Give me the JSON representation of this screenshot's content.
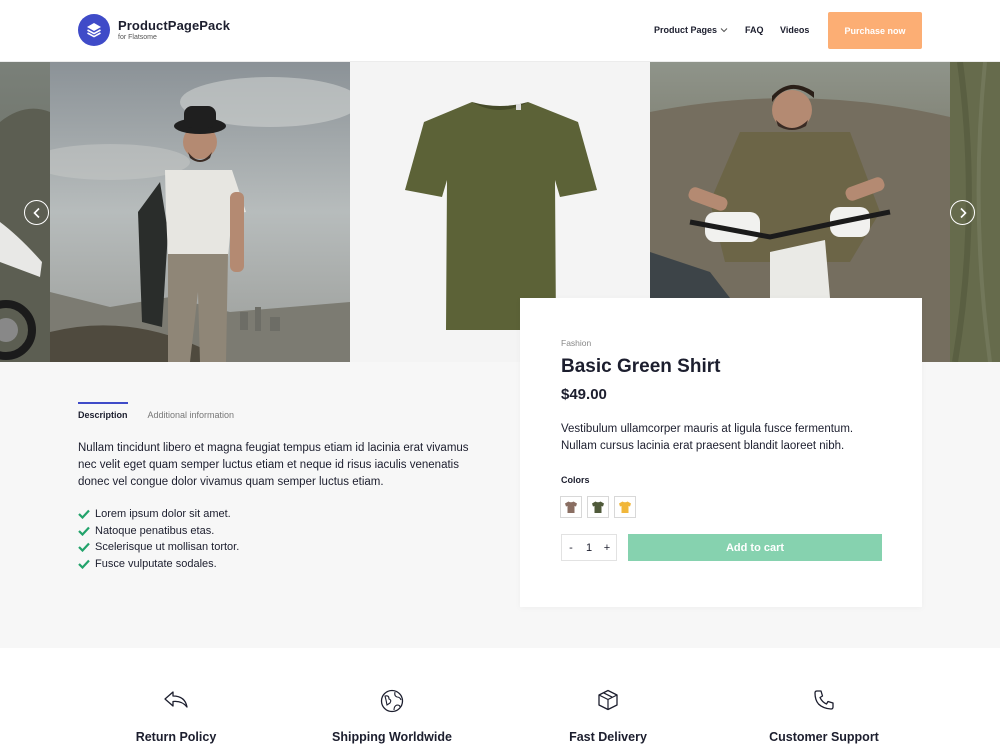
{
  "brand": {
    "name": "ProductPagePack",
    "sub": "for Flatsome"
  },
  "nav": {
    "items": [
      {
        "label": "Product Pages"
      },
      {
        "label": "FAQ"
      },
      {
        "label": "Videos"
      }
    ],
    "purchase_label": "Purchase now"
  },
  "tabs": [
    {
      "label": "Description"
    },
    {
      "label": "Additional information"
    }
  ],
  "description": "Nullam tincidunt libero et magna feugiat tempus etiam id lacinia erat vivamus nec velit eget quam semper luctus etiam et neque id risus iaculis venenatis donec vel congue dolor vivamus quam semper luctus etiam.",
  "checklist": [
    "Lorem ipsum dolor sit amet.",
    "Natoque penatibus etas.",
    "Scelerisque ut mollisan tortor.",
    "Fusce vulputate sodales."
  ],
  "product": {
    "category": "Fashion",
    "title": "Basic Green Shirt",
    "price": "$49.00",
    "description": "Vestibulum ullamcorper mauris at ligula fusce fermentum. Nullam cursus lacinia erat praesent blandit laoreet nibh.",
    "colors_label": "Colors",
    "colors": [
      "#8a6e62",
      "#4f5a3a",
      "#f1b73a"
    ],
    "qty": "1",
    "qty_minus": "-",
    "qty_plus": "+",
    "add_label": "Add to cart"
  },
  "features": [
    {
      "label": "Return Policy",
      "icon": "return-arrow-icon"
    },
    {
      "label": "Shipping Worldwide",
      "icon": "globe-icon"
    },
    {
      "label": "Fast Delivery",
      "icon": "box-icon"
    },
    {
      "label": "Customer Support",
      "icon": "phone-icon"
    }
  ],
  "colors": {
    "accent": "#3f4bc8",
    "purchase": "#fcae74",
    "add_to_cart": "#86d2af",
    "check": "#22a36b"
  }
}
